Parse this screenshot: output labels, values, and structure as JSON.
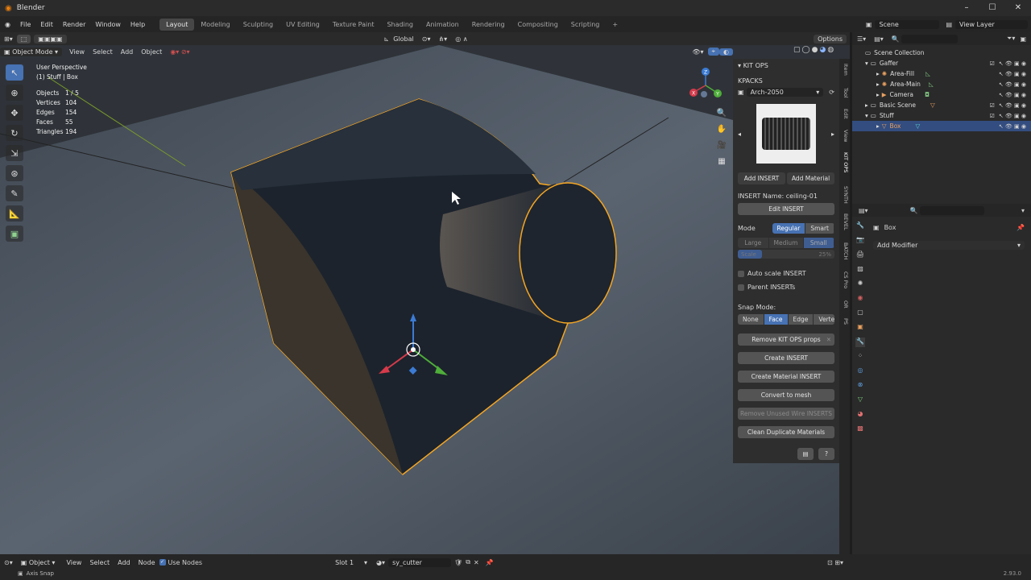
{
  "window": {
    "title": "Blender",
    "controls": [
      "–",
      "☐",
      "✕"
    ]
  },
  "menu": {
    "items": [
      "File",
      "Edit",
      "Render",
      "Window",
      "Help"
    ]
  },
  "workspaces": {
    "tabs": [
      "Layout",
      "Modeling",
      "Sculpting",
      "UV Editing",
      "Texture Paint",
      "Shading",
      "Animation",
      "Rendering",
      "Compositing",
      "Scripting"
    ],
    "active": "Layout"
  },
  "topbar": {
    "scene": "Scene",
    "view_layer": "View Layer"
  },
  "viewport": {
    "transform_orientation": "Global",
    "options": "Options",
    "mode": "Object Mode",
    "menus": [
      "View",
      "Select",
      "Add",
      "Object"
    ],
    "perspective": "User Perspective",
    "collection_object": "(1) Stuff | Box",
    "stats": [
      {
        "label": "Objects",
        "value": "1 / 5"
      },
      {
        "label": "Vertices",
        "value": "104"
      },
      {
        "label": "Edges",
        "value": "154"
      },
      {
        "label": "Faces",
        "value": "55"
      },
      {
        "label": "Triangles",
        "value": "194"
      }
    ],
    "gizmo_axes": [
      "X",
      "Y",
      "Z"
    ],
    "colors": {
      "selection_outline": "#f5a623",
      "floor": "#48505a",
      "object": "#1c232c",
      "accent": "#4772b3"
    }
  },
  "kitops": {
    "title": "KIT OPS",
    "kpacks_label": "KPACKS",
    "kpack": "Arch-2050",
    "add_insert": "Add INSERT",
    "add_material": "Add Material",
    "insert_name": "INSERT Name: ceiling-01",
    "edit_insert": "Edit INSERT",
    "mode_label": "Mode",
    "modes": [
      "Regular",
      "Smart"
    ],
    "mode_active": "Regular",
    "sizes": [
      "Large",
      "Medium",
      "Small"
    ],
    "size_active": "Small",
    "scale_label": "Scale",
    "scale_value": "25%",
    "auto_scale": "Auto scale INSERT",
    "parent_inserts": "Parent INSERTs",
    "snap_label": "Snap Mode:",
    "snap_modes": [
      "None",
      "Face",
      "Edge",
      "Vertex"
    ],
    "snap_active": "Face",
    "buttons": [
      "Remove KIT OPS props",
      "Create INSERT",
      "Create Material INSERT",
      "Convert to mesh",
      "Remove Unused Wire INSERTS",
      "Clean Duplicate Materials"
    ]
  },
  "side_tabs": [
    "Item",
    "Tool",
    "Edit",
    "View",
    "KIT OPS",
    "SYNTH",
    "BEVEL",
    "BATCH",
    "CS Pro",
    "OR",
    "PS"
  ],
  "outliner": {
    "rows": [
      {
        "label": "Scene Collection",
        "indent": 0
      },
      {
        "label": "Gaffer",
        "indent": 1
      },
      {
        "label": "Area-Fill",
        "indent": 2
      },
      {
        "label": "Area-Main",
        "indent": 2
      },
      {
        "label": "Camera",
        "indent": 2
      },
      {
        "label": "Basic Scene",
        "indent": 1
      },
      {
        "label": "Stuff",
        "indent": 1
      },
      {
        "label": "Box",
        "indent": 2,
        "selected": true
      }
    ]
  },
  "properties": {
    "object_name": "Box",
    "add_modifier": "Add Modifier"
  },
  "bottom": {
    "editor": "Object",
    "menus": [
      "View",
      "Select",
      "Add",
      "Node"
    ],
    "use_nodes": "Use Nodes",
    "slot": "Slot 1",
    "material": "sy_cutter",
    "status": "Axis Snap",
    "version": "2.93.0"
  }
}
